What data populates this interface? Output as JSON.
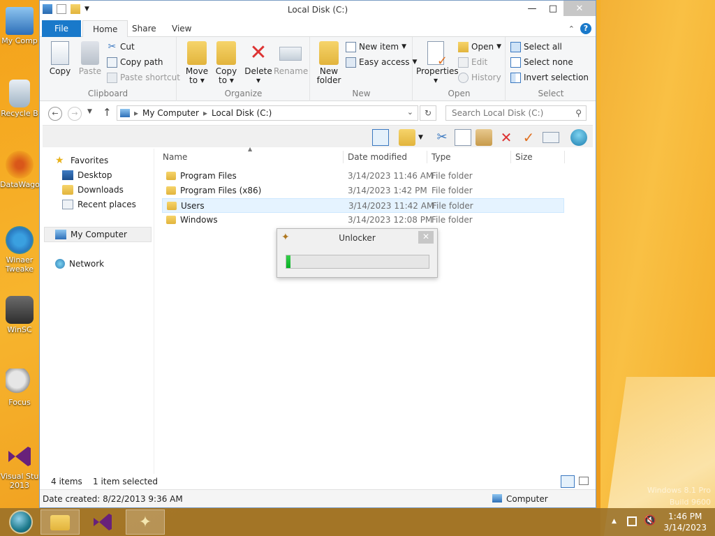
{
  "desktop": {
    "icons": [
      {
        "label": "My Comp"
      },
      {
        "label": "Recycle B"
      },
      {
        "label": "DataWago"
      },
      {
        "label": "Winaer Tweake"
      },
      {
        "label": "WinSC"
      },
      {
        "label": "Focus"
      },
      {
        "label": "Visual Stu 2013"
      }
    ],
    "watermark_line1": "Windows 8.1 Pro",
    "watermark_line2": "Build 9600"
  },
  "window": {
    "title": "Local Disk (C:)",
    "tabs": {
      "file": "File",
      "home": "Home",
      "share": "Share",
      "view": "View"
    }
  },
  "ribbon": {
    "clipboard": {
      "label": "Clipboard",
      "copy": "Copy",
      "paste": "Paste",
      "cut": "Cut",
      "copy_path": "Copy path",
      "paste_shortcut": "Paste shortcut"
    },
    "organize": {
      "label": "Organize",
      "move_to_1": "Move",
      "move_to_2": "to",
      "copy_to_1": "Copy",
      "copy_to_2": "to",
      "delete": "Delete",
      "rename": "Rename"
    },
    "new": {
      "label": "New",
      "new_folder_1": "New",
      "new_folder_2": "folder",
      "new_item": "New item",
      "easy_access": "Easy access"
    },
    "open": {
      "label": "Open",
      "properties": "Properties",
      "open": "Open",
      "edit": "Edit",
      "history": "History"
    },
    "select": {
      "label": "Select",
      "select_all": "Select all",
      "select_none": "Select none",
      "invert": "Invert selection"
    }
  },
  "address": {
    "crumbs": [
      "My Computer",
      "Local Disk (C:)"
    ],
    "search_placeholder": "Search Local Disk (C:)"
  },
  "navigation": {
    "favorites": "Favorites",
    "desktop": "Desktop",
    "downloads": "Downloads",
    "recent": "Recent places",
    "my_computer": "My Computer",
    "network": "Network"
  },
  "files": {
    "columns": {
      "name": "Name",
      "date": "Date modified",
      "type": "Type",
      "size": "Size"
    },
    "rows": [
      {
        "name": "Program Files",
        "date": "3/14/2023 11:46 AM",
        "type": "File folder"
      },
      {
        "name": "Program Files (x86)",
        "date": "3/14/2023 1:42 PM",
        "type": "File folder"
      },
      {
        "name": "Users",
        "date": "3/14/2023 11:42 AM",
        "type": "File folder"
      },
      {
        "name": "Windows",
        "date": "3/14/2023 12:08 PM",
        "type": "File folder"
      }
    ]
  },
  "status": {
    "count": "4 items",
    "selected": "1 item selected",
    "date_created": "Date created: 8/22/2013 9:36 AM",
    "location": "Computer"
  },
  "dialog": {
    "title": "Unlocker",
    "progress": 0.03
  },
  "taskbar": {
    "time": "1:46 PM",
    "date": "3/14/2023"
  },
  "colors": {
    "accent": "#1979ca",
    "progress": "#06b025",
    "selection": "#e5f3ff"
  }
}
